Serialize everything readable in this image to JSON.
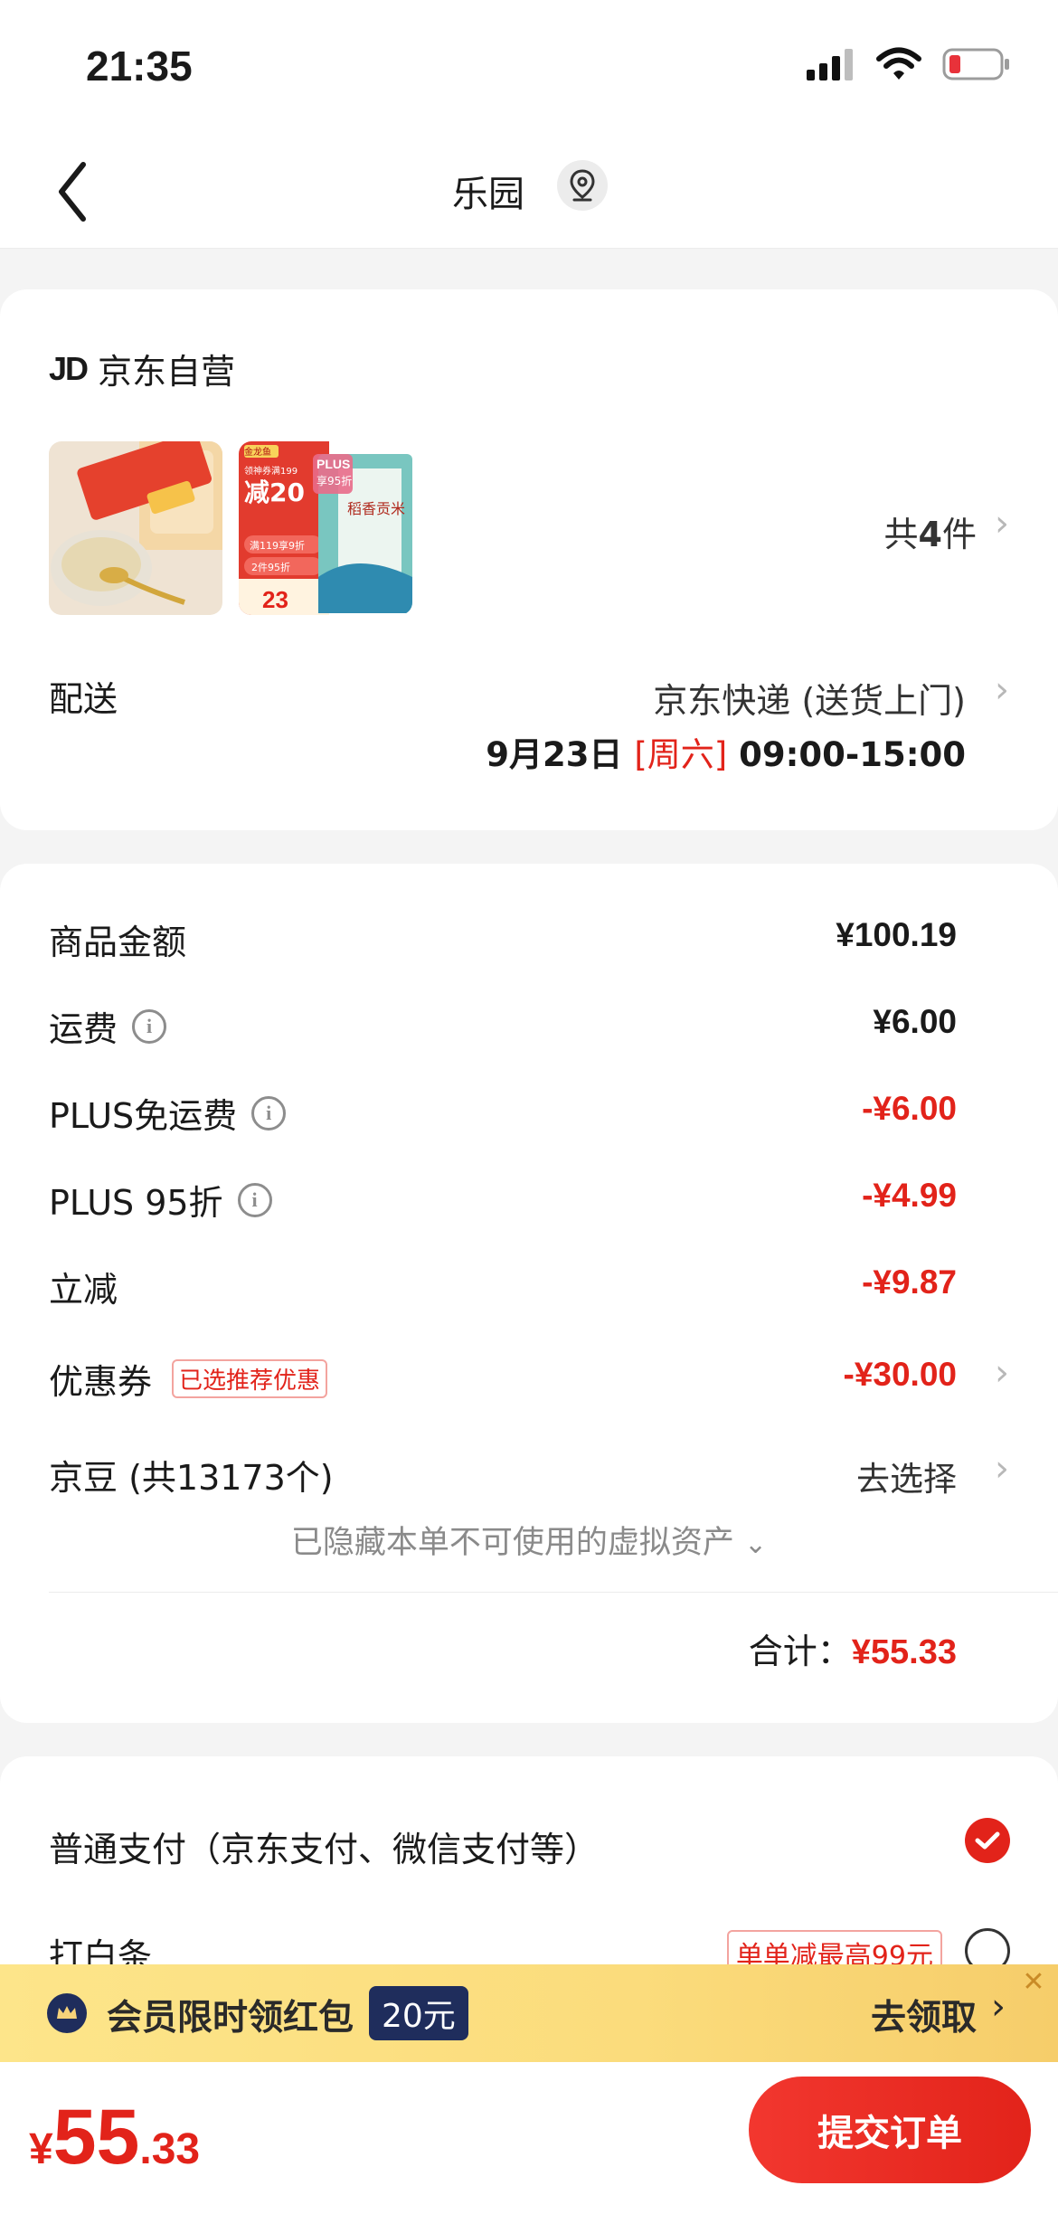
{
  "status_bar": {
    "time": "21:35"
  },
  "nav": {
    "title": "乐园"
  },
  "shop": {
    "logo_text": "JD",
    "name": "京东自营",
    "item_count_prefix": "共",
    "item_count": "4",
    "item_count_suffix": "件"
  },
  "product_images": [
    {
      "desc": "biscuit product",
      "text": ""
    },
    {
      "desc": "rice product",
      "promo_top": "领神券满199",
      "promo_big": "减20",
      "promo_mid": "满119享9折",
      "promo_mid2": "2件95折",
      "promo_price": "23",
      "plus_text": "PLUS",
      "plus_sub": "享95折",
      "brand": "金龙鱼",
      "rice_name": "稻香贡米"
    }
  ],
  "delivery": {
    "label": "配送",
    "method": "京东快递 (送货上门)",
    "date": "9月23日",
    "weekday": "[周六]",
    "time_range": "09:00-15:00"
  },
  "summary": {
    "goods_label": "商品金额",
    "goods_value": "¥100.19",
    "shipping_label": "运费",
    "shipping_value": "¥6.00",
    "plus_free_ship_label": "PLUS免运费",
    "plus_free_ship_value": "-¥6.00",
    "plus_discount_label": "PLUS 95折",
    "plus_discount_value": "-¥4.99",
    "instant_off_label": "立减",
    "instant_off_value": "-¥9.87",
    "coupon_label": "优惠券",
    "coupon_tag": "已选推荐优惠",
    "coupon_value": "-¥30.00",
    "jingdou_label": "京豆 (共13173个)",
    "jingdou_value": "去选择",
    "hidden_note": "已隐藏本单不可使用的虚拟资产",
    "total_label": "合计：",
    "total_value": "¥55.33"
  },
  "payment": {
    "normal_label": "普通支付（京东支付、微信支付等）",
    "baitiao_label": "打白条",
    "baitiao_promo": "单单减最高99元"
  },
  "banner": {
    "text": "会员限时领红包",
    "amount": "20元",
    "cta": "去领取"
  },
  "footer": {
    "currency": "¥",
    "price_int": "55",
    "price_dec": ".33",
    "submit_label": "提交订单"
  },
  "colors": {
    "accent_red": "#e2231a",
    "banner_navy": "#1f2d5c",
    "banner_yellow": "#fde58a"
  }
}
